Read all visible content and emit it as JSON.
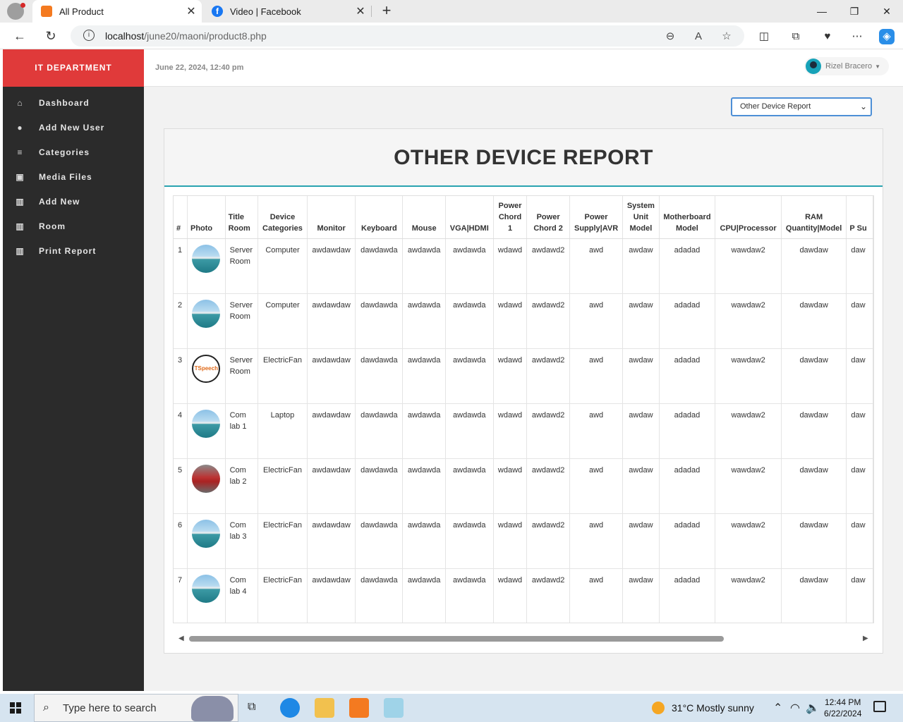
{
  "browser": {
    "tabs": [
      {
        "title": "All Product",
        "icon": "xampp-icon",
        "active": true
      },
      {
        "title": "Video | Facebook",
        "icon": "facebook-icon",
        "active": false
      }
    ],
    "url_host": "localhost",
    "url_path": "/june20/maoni/product8.php"
  },
  "sidebar": {
    "brand": "IT DEPARTMENT",
    "items": [
      {
        "label": "Dashboard",
        "icon": "home-icon"
      },
      {
        "label": "Add New User",
        "icon": "user-icon"
      },
      {
        "label": "Categories",
        "icon": "sliders-icon"
      },
      {
        "label": "Media Files",
        "icon": "image-icon"
      },
      {
        "label": "Add New",
        "icon": "grid-icon"
      },
      {
        "label": "Room",
        "icon": "grid-icon"
      },
      {
        "label": "Print Report",
        "icon": "grid-icon"
      }
    ]
  },
  "header": {
    "datetime": "June 22, 2024, 12:40 pm",
    "user_name": "Rizel Bracero"
  },
  "report_select": {
    "selected": "Other Device Report"
  },
  "panel": {
    "title": "OTHER DEVICE REPORT"
  },
  "table": {
    "headers": [
      "#",
      "Photo",
      "Title Room",
      "Device Categories",
      "Monitor",
      "Keyboard",
      "Mouse",
      "VGA|HDMI",
      "Power Chord 1",
      "Power Chord 2",
      "Power Supply|AVR",
      "System Unit Model",
      "Motherboard Model",
      "CPU|Processor",
      "RAM Quantity|Model",
      "P Su"
    ],
    "rows": [
      {
        "num": "1",
        "photo": "sea",
        "room": "Server Room",
        "category": "Computer",
        "monitor": "awdawdaw",
        "keyboard": "dawdawda",
        "mouse": "awdawda",
        "vga": "awdawda",
        "pc1": "wdawd",
        "pc2": "awdawd2",
        "psu": "awd",
        "sum": "awdaw",
        "mobo": "adadad",
        "cpu": "wawdaw2",
        "ram": "dawdaw",
        "extra": "daw"
      },
      {
        "num": "2",
        "photo": "sea",
        "room": "Server Room",
        "category": "Computer",
        "monitor": "awdawdaw",
        "keyboard": "dawdawda",
        "mouse": "awdawda",
        "vga": "awdawda",
        "pc1": "wdawd",
        "pc2": "awdawd2",
        "psu": "awd",
        "sum": "awdaw",
        "mobo": "adadad",
        "cpu": "wawdaw2",
        "ram": "dawdaw",
        "extra": "daw"
      },
      {
        "num": "3",
        "photo": "tspeech",
        "room": "Server Room",
        "category": "ElectricFan",
        "monitor": "awdawdaw",
        "keyboard": "dawdawda",
        "mouse": "awdawda",
        "vga": "awdawda",
        "pc1": "wdawd",
        "pc2": "awdawd2",
        "psu": "awd",
        "sum": "awdaw",
        "mobo": "adadad",
        "cpu": "wawdaw2",
        "ram": "dawdaw",
        "extra": "daw"
      },
      {
        "num": "4",
        "photo": "sea",
        "room": "Com lab 1",
        "category": "Laptop",
        "monitor": "awdawdaw",
        "keyboard": "dawdawda",
        "mouse": "awdawda",
        "vga": "awdawda",
        "pc1": "wdawd",
        "pc2": "awdawd2",
        "psu": "awd",
        "sum": "awdaw",
        "mobo": "adadad",
        "cpu": "wawdaw2",
        "ram": "dawdaw",
        "extra": "daw"
      },
      {
        "num": "5",
        "photo": "building",
        "room": "Com lab 2",
        "category": "ElectricFan",
        "monitor": "awdawdaw",
        "keyboard": "dawdawda",
        "mouse": "awdawda",
        "vga": "awdawda",
        "pc1": "wdawd",
        "pc2": "awdawd2",
        "psu": "awd",
        "sum": "awdaw",
        "mobo": "adadad",
        "cpu": "wawdaw2",
        "ram": "dawdaw",
        "extra": "daw"
      },
      {
        "num": "6",
        "photo": "sea",
        "room": "Com lab 3",
        "category": "ElectricFan",
        "monitor": "awdawdaw",
        "keyboard": "dawdawda",
        "mouse": "awdawda",
        "vga": "awdawda",
        "pc1": "wdawd",
        "pc2": "awdawd2",
        "psu": "awd",
        "sum": "awdaw",
        "mobo": "adadad",
        "cpu": "wawdaw2",
        "ram": "dawdaw",
        "extra": "daw"
      },
      {
        "num": "7",
        "photo": "sea",
        "room": "Com lab 4",
        "category": "ElectricFan",
        "monitor": "awdawdaw",
        "keyboard": "dawdawda",
        "mouse": "awdawda",
        "vga": "awdawda",
        "pc1": "wdawd",
        "pc2": "awdawd2",
        "psu": "awd",
        "sum": "awdaw",
        "mobo": "adadad",
        "cpu": "wawdaw2",
        "ram": "dawdaw",
        "extra": "daw"
      }
    ],
    "tspeech_logo_text": "TSpeech"
  },
  "taskbar": {
    "search_placeholder": "Type here to search",
    "weather": "31°C  Mostly sunny",
    "time": "12:44 PM",
    "date": "6/22/2024"
  },
  "colors": {
    "brand_red": "#e03a3a",
    "sidebar_bg": "#2b2b2b",
    "accent_teal": "#2aa3b0",
    "select_border": "#4d8fd6"
  }
}
